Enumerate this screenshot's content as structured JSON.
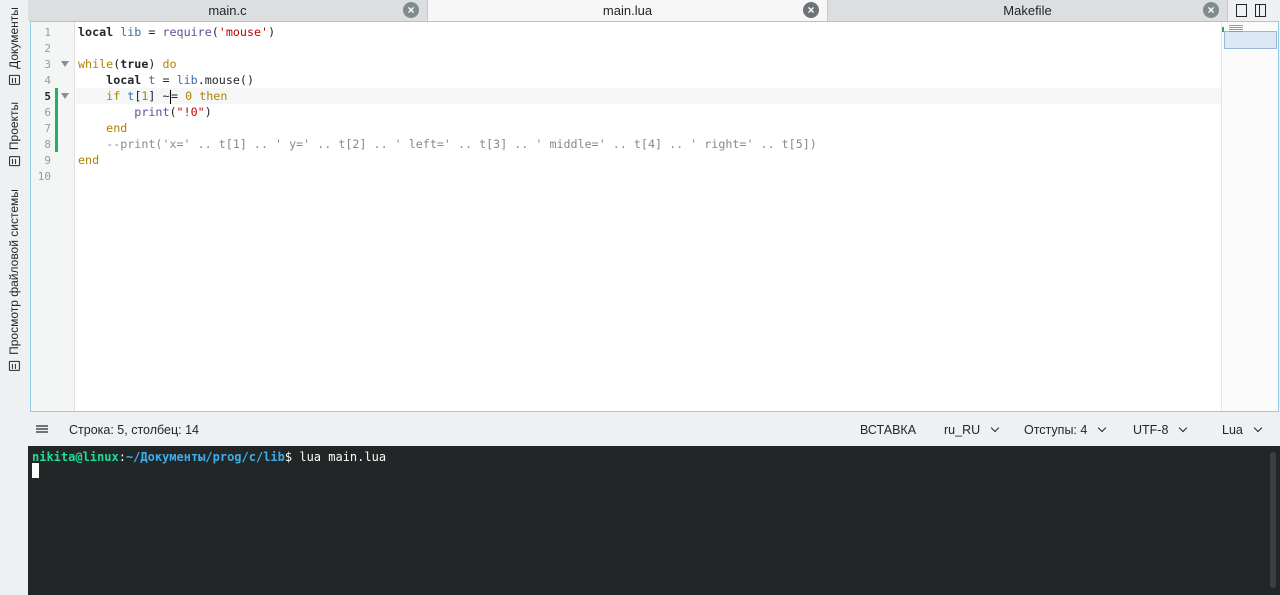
{
  "sidebar": {
    "items": [
      {
        "label": "Документы"
      },
      {
        "label": "Проекты"
      },
      {
        "label": "Просмотр файловой системы"
      }
    ]
  },
  "tabs": [
    {
      "label": "main.c",
      "active": false
    },
    {
      "label": "main.lua",
      "active": true
    },
    {
      "label": "Makefile",
      "active": false
    }
  ],
  "tab_close_glyph": "×",
  "editor": {
    "line_numbers": [
      "1",
      "2",
      "3",
      "4",
      "5",
      "6",
      "7",
      "8",
      "9",
      "10"
    ],
    "current_line": 5,
    "lines": [
      {
        "tokens": [
          {
            "t": "local",
            "c": "kw"
          },
          {
            "t": " ",
            "c": ""
          },
          {
            "t": "lib",
            "c": "var"
          },
          {
            "t": " = ",
            "c": ""
          },
          {
            "t": "require",
            "c": "fn"
          },
          {
            "t": "(",
            "c": ""
          },
          {
            "t": "'mouse'",
            "c": "str"
          },
          {
            "t": ")",
            "c": ""
          }
        ]
      },
      {
        "tokens": []
      },
      {
        "tokens": [
          {
            "t": "while",
            "c": "cf"
          },
          {
            "t": "(",
            "c": ""
          },
          {
            "t": "true",
            "c": "kw"
          },
          {
            "t": ") ",
            "c": ""
          },
          {
            "t": "do",
            "c": "cf"
          }
        ]
      },
      {
        "tokens": [
          {
            "t": "    ",
            "c": ""
          },
          {
            "t": "local",
            "c": "kw"
          },
          {
            "t": " ",
            "c": ""
          },
          {
            "t": "t",
            "c": "var"
          },
          {
            "t": " = ",
            "c": ""
          },
          {
            "t": "lib",
            "c": "var"
          },
          {
            "t": ".mouse()",
            "c": ""
          }
        ]
      },
      {
        "tokens": [
          {
            "t": "    ",
            "c": ""
          },
          {
            "t": "if",
            "c": "cf"
          },
          {
            "t": " ",
            "c": ""
          },
          {
            "t": "t",
            "c": "var"
          },
          {
            "t": "[",
            "c": ""
          },
          {
            "t": "1",
            "c": "num"
          },
          {
            "t": "] ",
            "c": ""
          },
          {
            "t": "~",
            "c": ""
          },
          {
            "t": "|CARET|",
            "c": "caret"
          },
          {
            "t": "= ",
            "c": ""
          },
          {
            "t": "0",
            "c": "num"
          },
          {
            "t": " ",
            "c": ""
          },
          {
            "t": "then",
            "c": "cf"
          }
        ]
      },
      {
        "tokens": [
          {
            "t": "        ",
            "c": ""
          },
          {
            "t": "print",
            "c": "fn"
          },
          {
            "t": "(",
            "c": ""
          },
          {
            "t": "\"!0\"",
            "c": "str"
          },
          {
            "t": ")",
            "c": ""
          }
        ]
      },
      {
        "tokens": [
          {
            "t": "    ",
            "c": ""
          },
          {
            "t": "end",
            "c": "cf"
          }
        ]
      },
      {
        "tokens": [
          {
            "t": "    --print('x=' .. t[1] .. ' y=' .. t[2] .. ' left=' .. t[3] .. ' middle=' .. t[4] .. ' right=' .. t[5])",
            "c": "cmt"
          }
        ]
      },
      {
        "tokens": [
          {
            "t": "end",
            "c": "cf"
          }
        ]
      },
      {
        "tokens": []
      }
    ],
    "fold_lines": [
      3,
      5
    ],
    "modified_lines": [
      5,
      6,
      7,
      8
    ]
  },
  "statusbar": {
    "cursor_position": "Строка: 5, столбец: 14",
    "input_mode": "ВСТАВКА",
    "dictionary": "ru_RU",
    "indentation": "Отступы: 4",
    "encoding": "UTF-8",
    "syntax": "Lua"
  },
  "terminal": {
    "user_host": "nikita@linux",
    "separator": ":",
    "path": "~/Документы/prog/c/lib",
    "prompt_end": "$ ",
    "command": "lua main.lua"
  }
}
